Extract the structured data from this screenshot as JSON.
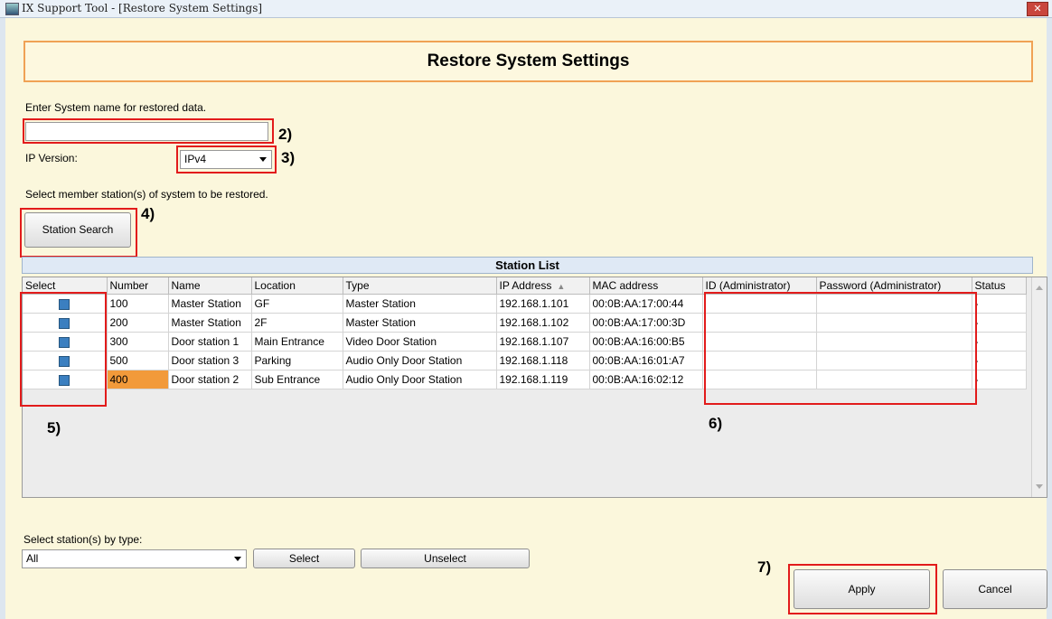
{
  "window": {
    "title": "IX Support Tool -  [Restore System Settings]",
    "close_glyph": "✕"
  },
  "header": {
    "title": "Restore System Settings"
  },
  "system_name": {
    "label": "Enter System name for restored data.",
    "value": ""
  },
  "ip_version": {
    "label": "IP Version:",
    "value": "IPv4"
  },
  "select_member_label": "Select member station(s) of system to be restored.",
  "station_search_button": "Station Search",
  "station_list": {
    "title": "Station List",
    "columns": [
      "Select",
      "Number",
      "Name",
      "Location",
      "Type",
      "IP Address",
      "MAC address",
      "ID (Administrator)",
      "Password (Administrator)",
      "Status"
    ],
    "rows": [
      {
        "number": "100",
        "name": "Master Station",
        "location": "GF",
        "type": "Master Station",
        "ip": "192.168.1.101",
        "mac": "00:0B:AA:17:00:44",
        "id": "",
        "password": "",
        "status": "-"
      },
      {
        "number": "200",
        "name": "Master Station",
        "location": "2F",
        "type": "Master Station",
        "ip": "192.168.1.102",
        "mac": "00:0B:AA:17:00:3D",
        "id": "",
        "password": "",
        "status": "-"
      },
      {
        "number": "300",
        "name": "Door station 1",
        "location": "Main Entrance",
        "type": "Video Door Station",
        "ip": "192.168.1.107",
        "mac": "00:0B:AA:16:00:B5",
        "id": "",
        "password": "",
        "status": "-"
      },
      {
        "number": "500",
        "name": "Door station 3",
        "location": "Parking",
        "type": "Audio Only Door Station",
        "ip": "192.168.1.118",
        "mac": "00:0B:AA:16:01:A7",
        "id": "",
        "password": "",
        "status": "-"
      },
      {
        "number": "400",
        "name": "Door station 2",
        "location": "Sub Entrance",
        "type": "Audio Only Door Station",
        "ip": "192.168.1.119",
        "mac": "00:0B:AA:16:02:12",
        "id": "",
        "password": "",
        "status": "-"
      }
    ]
  },
  "select_by_type": {
    "label": "Select station(s) by type:",
    "value": "All"
  },
  "buttons": {
    "select": "Select",
    "unselect": "Unselect",
    "apply": "Apply",
    "cancel": "Cancel"
  },
  "callouts": {
    "c2": "2)",
    "c3": "3)",
    "c4": "4)",
    "c5": "5)",
    "c6": "6)",
    "c7": "7)"
  },
  "colors": {
    "annotation_red": "#e21b1b",
    "header_border": "#f0a255",
    "highlight_cell": "#f29a3a",
    "checkbox_blue": "#3b7fc0"
  }
}
